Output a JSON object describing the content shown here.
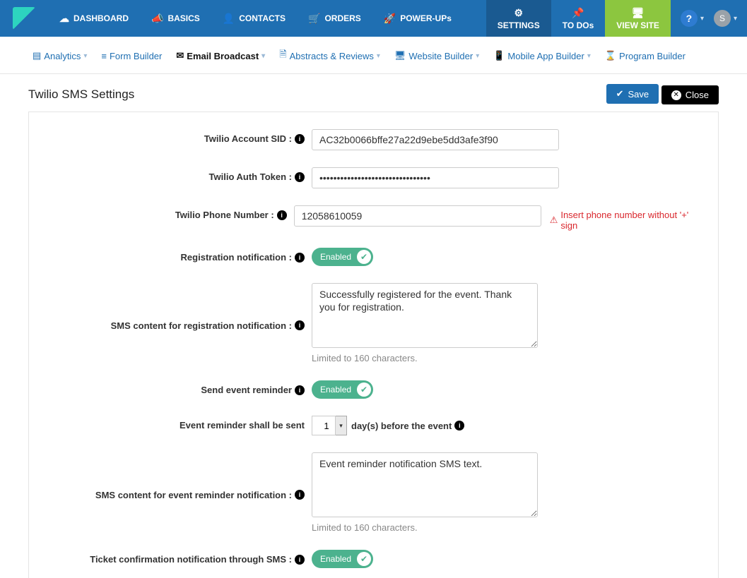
{
  "nav": {
    "dashboard": "DASHBOARD",
    "basics": "BASICS",
    "contacts": "CONTACTS",
    "orders": "ORDERS",
    "powerups": "POWER-UPs",
    "settings": "SETTINGS",
    "todos": "TO DOs",
    "viewsite": "VIEW SITE",
    "avatar": "S"
  },
  "subnav": {
    "analytics": "Analytics",
    "form_builder": "Form Builder",
    "email_broadcast": "Email Broadcast",
    "abstracts": "Abstracts & Reviews",
    "website_builder": "Website Builder",
    "mobile_app": "Mobile App Builder",
    "program_builder": "Program Builder"
  },
  "page": {
    "title": "Twilio SMS Settings",
    "save": "Save",
    "close": "Close"
  },
  "form": {
    "sid_label": "Twilio Account SID :",
    "sid_value": "AC32b0066bffe27a22d9ebe5dd3afe3f90",
    "token_label": "Twilio Auth Token :",
    "token_value": "••••••••••••••••••••••••••••••••",
    "phone_label": "Twilio Phone Number :",
    "phone_value": "12058610059",
    "phone_hint": "Insert phone number without '+' sign",
    "reg_notif_label": "Registration notification :",
    "enabled": "Enabled",
    "reg_sms_label": "SMS content for registration notification :",
    "reg_sms_value": "Successfully registered for the event. Thank you for registration.",
    "char_limit": "Limited to 160 characters.",
    "reminder_label": "Send event reminder",
    "reminder_days_pre": "Event reminder shall be sent",
    "reminder_days_value": "1",
    "reminder_days_post": "day(s) before the event",
    "reminder_sms_label": "SMS content for event reminder notification :",
    "reminder_sms_value": "Event reminder notification SMS text.",
    "ticket_label": "Ticket confirmation notification through SMS :"
  }
}
